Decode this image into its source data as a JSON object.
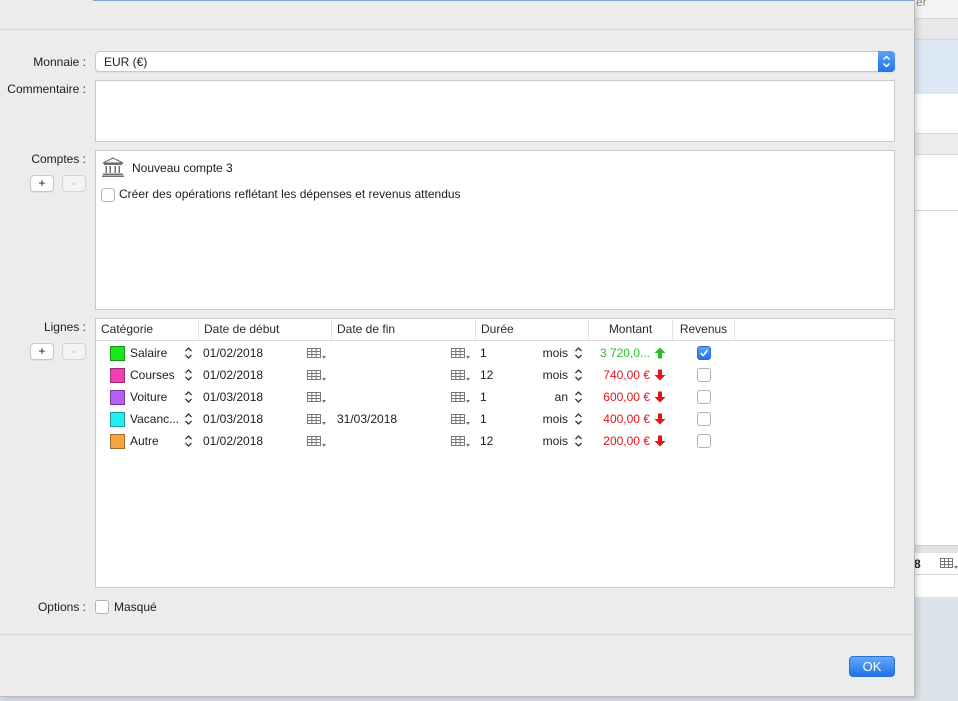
{
  "background_window": {
    "partial_top_text": "er",
    "partial_bottom_text": "8"
  },
  "form": {
    "currency_label": "Monnaie :",
    "currency_value": "EUR (€)",
    "comment_label": "Commentaire :",
    "comment_value": "",
    "accounts_label": "Comptes :",
    "account_name": "Nouveau compte 3",
    "create_ops_label": "Créer des opérations reflétant les dépenses et revenus attendus",
    "create_ops_checked": false,
    "lines_label": "Lignes :",
    "options_label": "Options :",
    "hidden_label": "Masqué",
    "hidden_checked": false,
    "add_label": "+",
    "remove_label": "-",
    "ok_label": "OK"
  },
  "table": {
    "headers": {
      "category": "Catégorie",
      "start_date": "Date de début",
      "end_date": "Date de fin",
      "duration": "Durée",
      "amount": "Montant",
      "income": "Revenus"
    },
    "rows": [
      {
        "color": "#1ee61e",
        "category": "Salaire",
        "start": "01/02/2018",
        "end": "",
        "duration": "1",
        "unit": "mois",
        "amount": "3 720,0...",
        "direction": "up",
        "income": true
      },
      {
        "color": "#f23fb4",
        "category": "Courses",
        "start": "01/02/2018",
        "end": "",
        "duration": "12",
        "unit": "mois",
        "amount": "740,00 €",
        "direction": "down",
        "income": false
      },
      {
        "color": "#b65ef0",
        "category": "Voiture",
        "start": "01/03/2018",
        "end": "",
        "duration": "1",
        "unit": "an",
        "amount": "600,00 €",
        "direction": "down",
        "income": false
      },
      {
        "color": "#22f0f0",
        "category": "Vacanc...",
        "start": "01/03/2018",
        "end": "31/03/2018",
        "duration": "1",
        "unit": "mois",
        "amount": "400,00 €",
        "direction": "down",
        "income": false
      },
      {
        "color": "#f9a43c",
        "category": "Autre",
        "start": "01/02/2018",
        "end": "",
        "duration": "12",
        "unit": "mois",
        "amount": "200,00 €",
        "direction": "down",
        "income": false
      }
    ]
  },
  "colors": {
    "accent": "#2074e8",
    "positive": "#23c21f",
    "negative": "#e3151a"
  },
  "icons": {
    "bank": "bank-icon",
    "calendar": "calendar-icon",
    "stepper": "stepper-icon",
    "arrow_up": "arrow-up-icon",
    "arrow_down": "arrow-down-icon"
  }
}
